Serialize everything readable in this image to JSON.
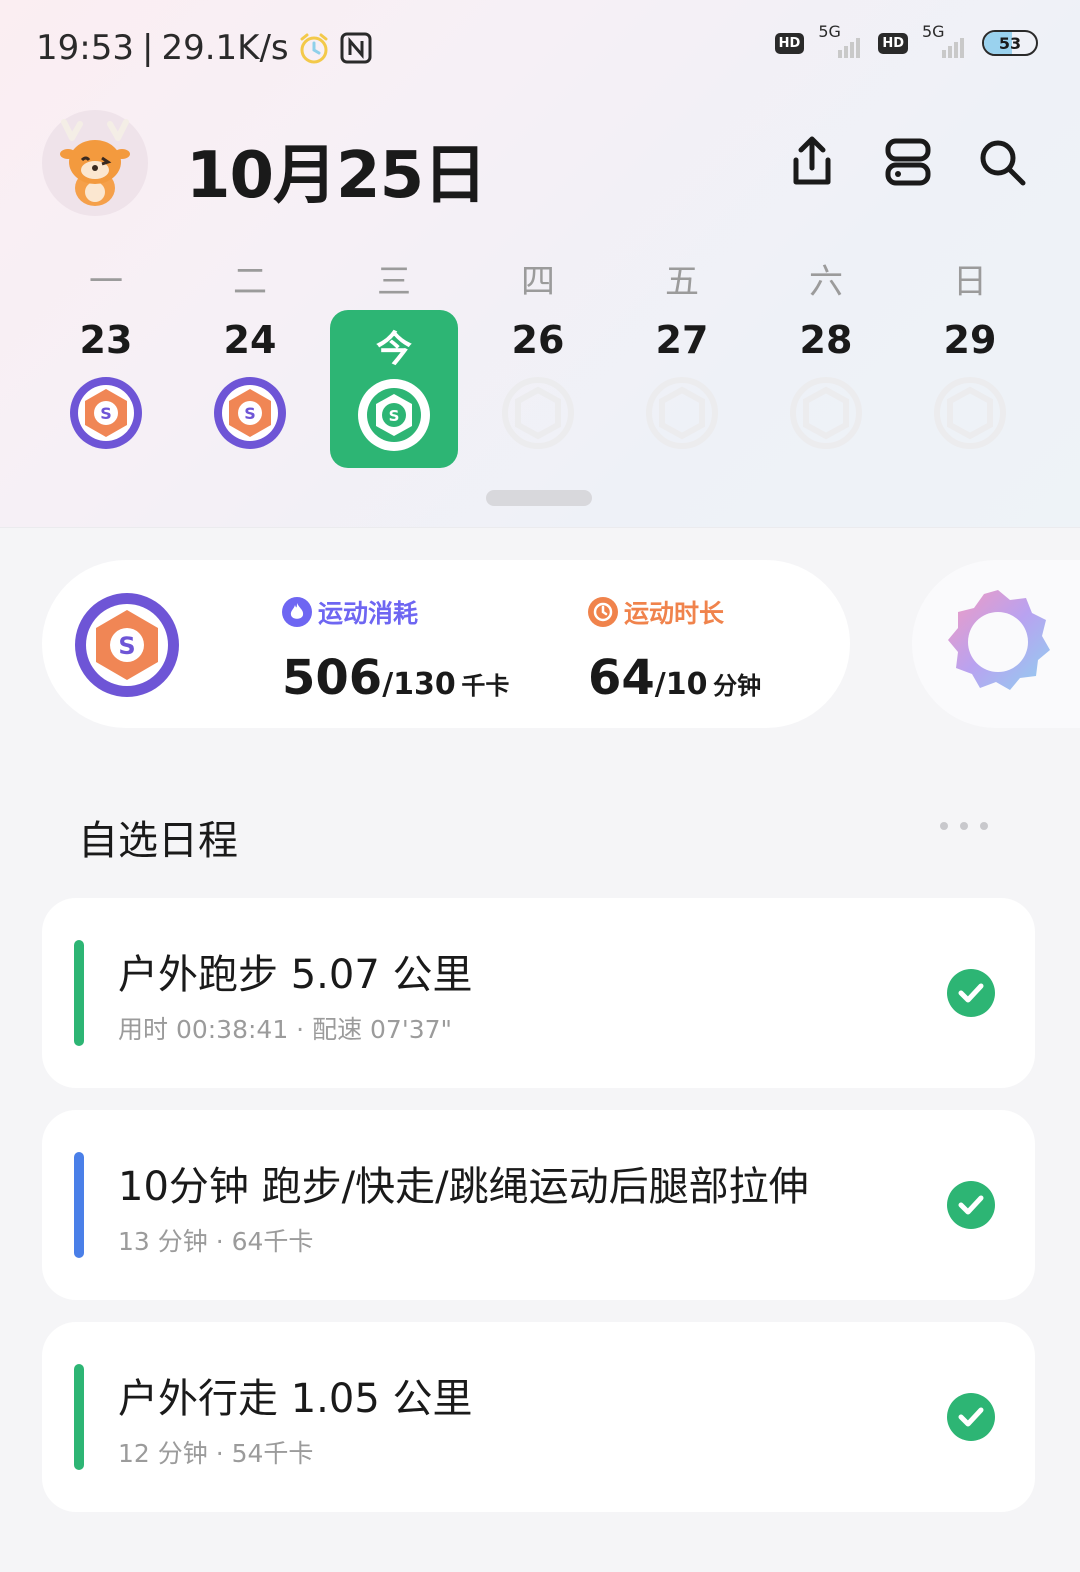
{
  "colors": {
    "accent_green": "#2db574",
    "calorie_blue": "#6e66f2",
    "duration_orange": "#f0834c",
    "card_bar_green": "#2db574",
    "card_bar_blue": "#4a7fe8",
    "badge_purple": "#6e55d6",
    "badge_orange": "#f08655"
  },
  "status_bar": {
    "time": "19:53",
    "network_speed": "29.1K/s",
    "alarm_icon": "alarm-clock-icon",
    "nfc_icon": "nfc-icon",
    "sim1_hd": "HD",
    "sim1_net": "5G",
    "sim2_hd": "HD",
    "sim2_net": "5G",
    "battery": "53"
  },
  "header": {
    "date_title": "10月25日",
    "icons": [
      "share-icon",
      "devices-icon",
      "search-icon"
    ]
  },
  "week": {
    "days": [
      {
        "weekday": "一",
        "date": "23",
        "status": "achieved"
      },
      {
        "weekday": "二",
        "date": "24",
        "status": "achieved"
      },
      {
        "weekday": "三",
        "date": "今",
        "status": "today"
      },
      {
        "weekday": "四",
        "date": "26",
        "status": "future"
      },
      {
        "weekday": "五",
        "date": "27",
        "status": "future"
      },
      {
        "weekday": "六",
        "date": "28",
        "status": "future"
      },
      {
        "weekday": "日",
        "date": "29",
        "status": "future"
      }
    ]
  },
  "summary": {
    "badge_letter": "S",
    "calories": {
      "label": "运动消耗",
      "value": "506",
      "goal": "/130",
      "unit": "千卡",
      "icon": "flame-icon"
    },
    "duration": {
      "label": "运动时长",
      "value": "64",
      "goal": "/10",
      "unit": "分钟",
      "icon": "clock-icon"
    }
  },
  "schedule": {
    "title": "自选日程",
    "items": [
      {
        "title": "户外跑步 5.07 公里",
        "subtitle": "用时 00:38:41 · 配速 07'37\"",
        "bar": "green",
        "completed": true
      },
      {
        "title": "10分钟 跑步/快走/跳绳运动后腿部拉伸",
        "subtitle": "13 分钟 · 64千卡",
        "bar": "blue",
        "completed": true
      },
      {
        "title": "户外行走 1.05 公里",
        "subtitle": "12 分钟 · 54千卡",
        "bar": "green",
        "completed": true
      }
    ]
  }
}
